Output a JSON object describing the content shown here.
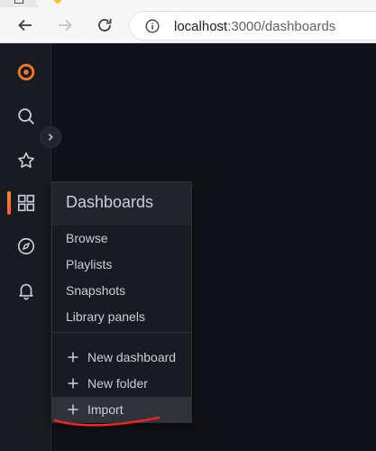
{
  "browser": {
    "url_host": "localhost",
    "url_path": ":3000/dashboards"
  },
  "sidemenu": {
    "items": [
      "grafana-logo",
      "search-icon",
      "star-icon",
      "dashboards-icon",
      "compass-icon",
      "bell-icon"
    ],
    "accent": "#f55f3e"
  },
  "flyout": {
    "title": "Dashboards",
    "links": [
      "Browse",
      "Playlists",
      "Snapshots",
      "Library panels"
    ],
    "actions": [
      "New dashboard",
      "New folder",
      "Import"
    ]
  },
  "annotation": {
    "color": "#e8262a",
    "shape": "underline-scribble"
  }
}
